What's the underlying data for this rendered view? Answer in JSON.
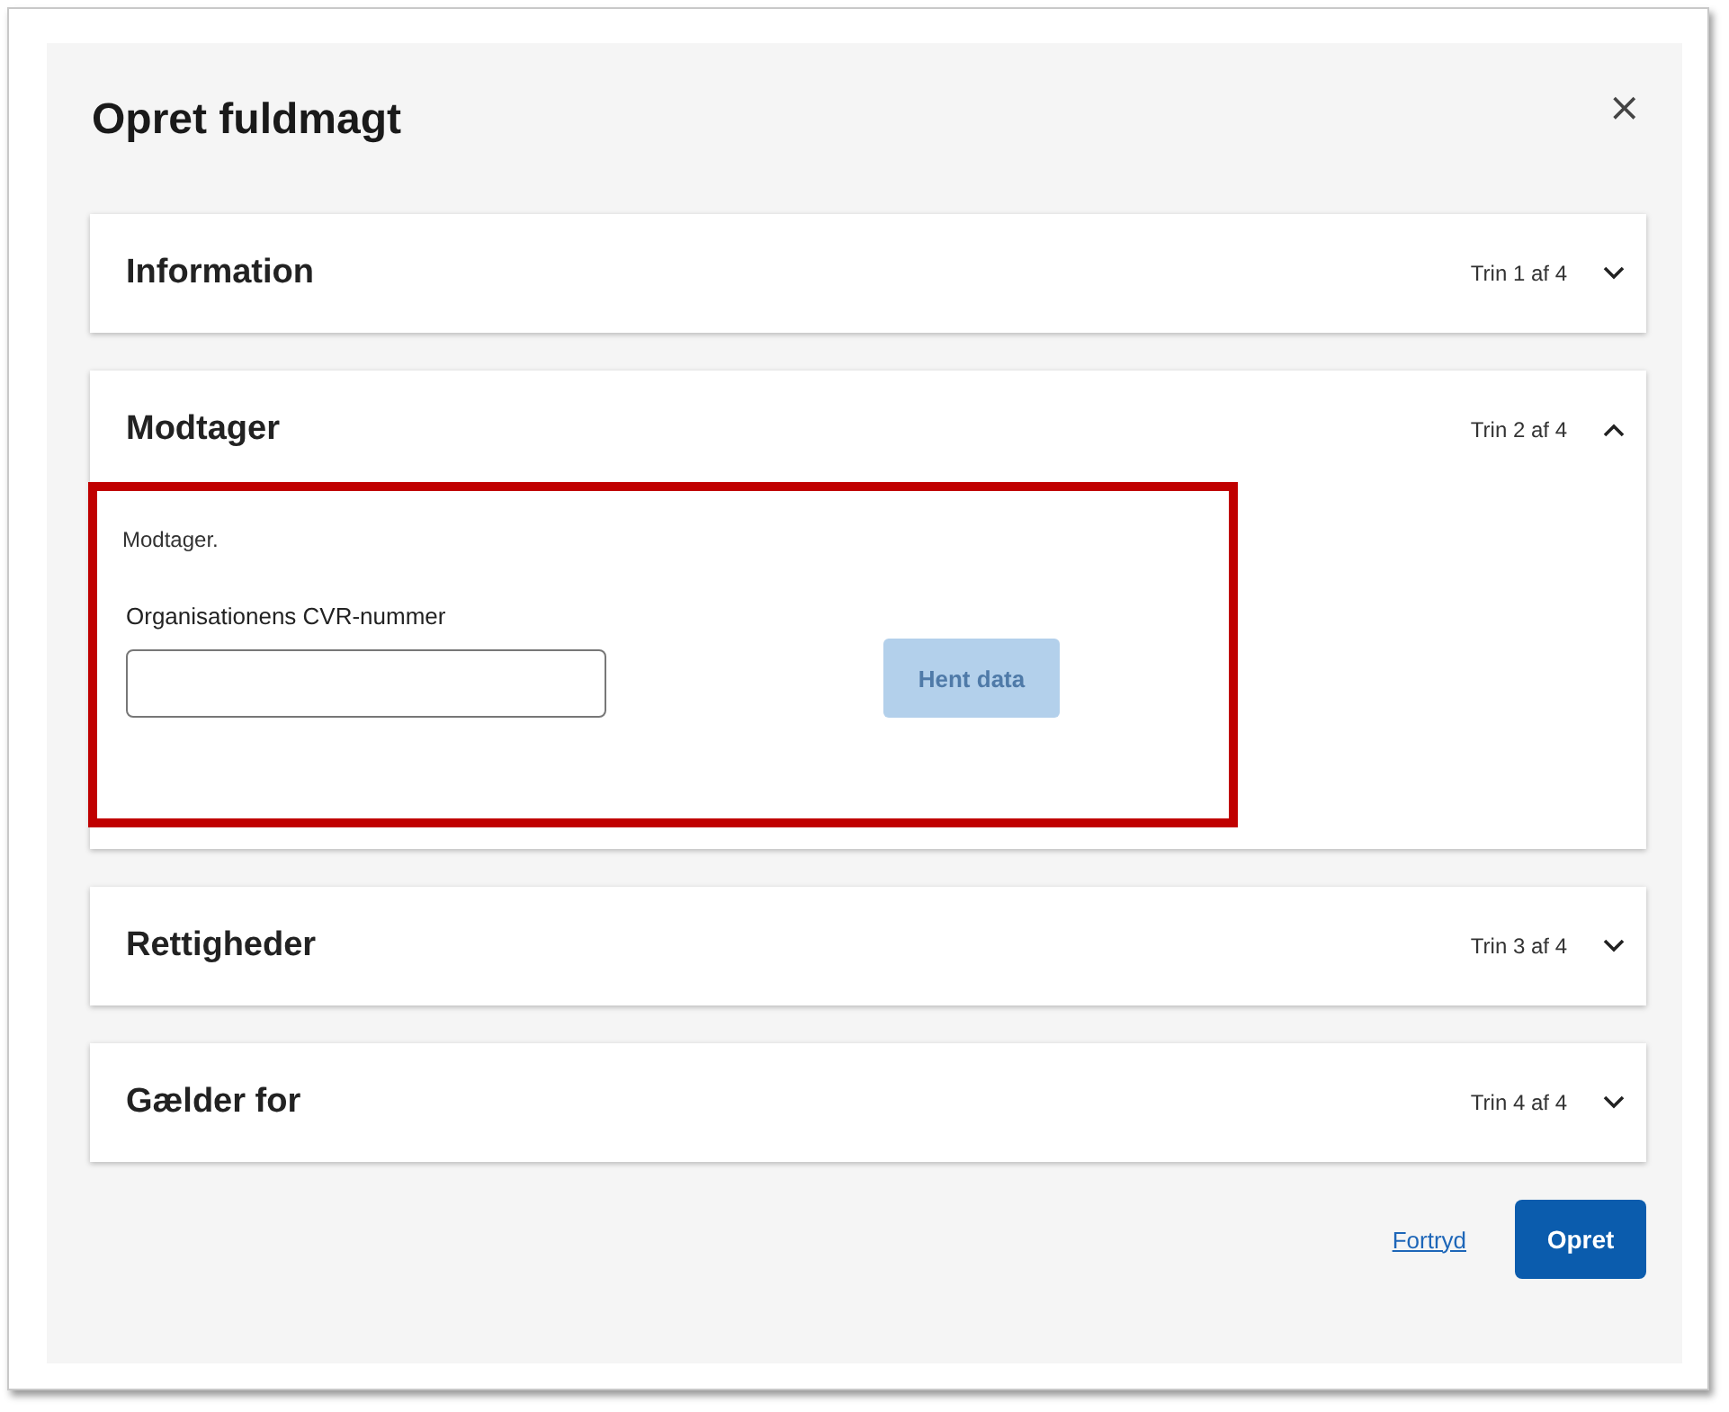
{
  "dialog": {
    "title": "Opret fuldmagt",
    "close": "×"
  },
  "sections": [
    {
      "title": "Information",
      "step": "Trin 1 af 4",
      "expanded": false
    },
    {
      "title": "Modtager",
      "step": "Trin 2 af 4",
      "expanded": true,
      "description": "Modtager.",
      "field": {
        "label": "Organisationens CVR-nummer"
      },
      "button": {
        "label": "Hent data",
        "disabled": true
      }
    },
    {
      "title": "Rettigheder",
      "step": "Trin 3 af 4",
      "expanded": false
    },
    {
      "title": "Gælder for",
      "step": "Trin 4 af 4",
      "expanded": false
    }
  ],
  "footer": {
    "cancel": "Fortryd",
    "submit": "Opret"
  }
}
